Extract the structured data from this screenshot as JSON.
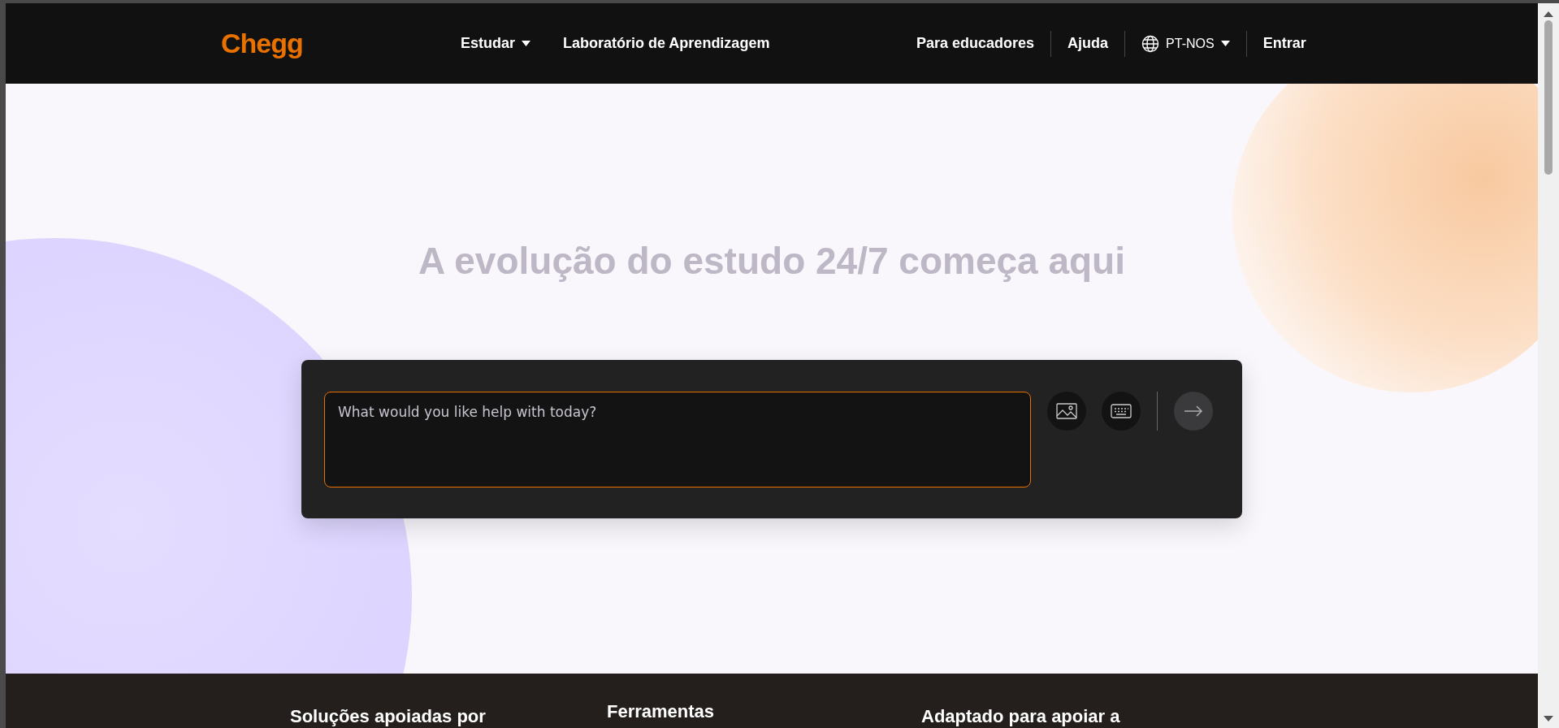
{
  "header": {
    "logo": "Chegg",
    "nav": [
      {
        "label": "Estudar",
        "dropdown": true
      },
      {
        "label": "Laboratório de Aprendizagem",
        "dropdown": false
      }
    ],
    "right": [
      {
        "kind": "link",
        "label": "Para educadores"
      },
      {
        "kind": "link",
        "label": "Ajuda"
      },
      {
        "kind": "language",
        "label": "PT-NOS"
      },
      {
        "kind": "link",
        "label": "Entrar"
      }
    ]
  },
  "hero": {
    "title": "A evolução do estudo 24/7 começa aqui"
  },
  "ask": {
    "placeholder": "What would you like help with today?"
  },
  "footer": {
    "columns": [
      "Soluções apoiadas por",
      "Ferramentas",
      "Adaptado para apoiar a"
    ]
  }
}
